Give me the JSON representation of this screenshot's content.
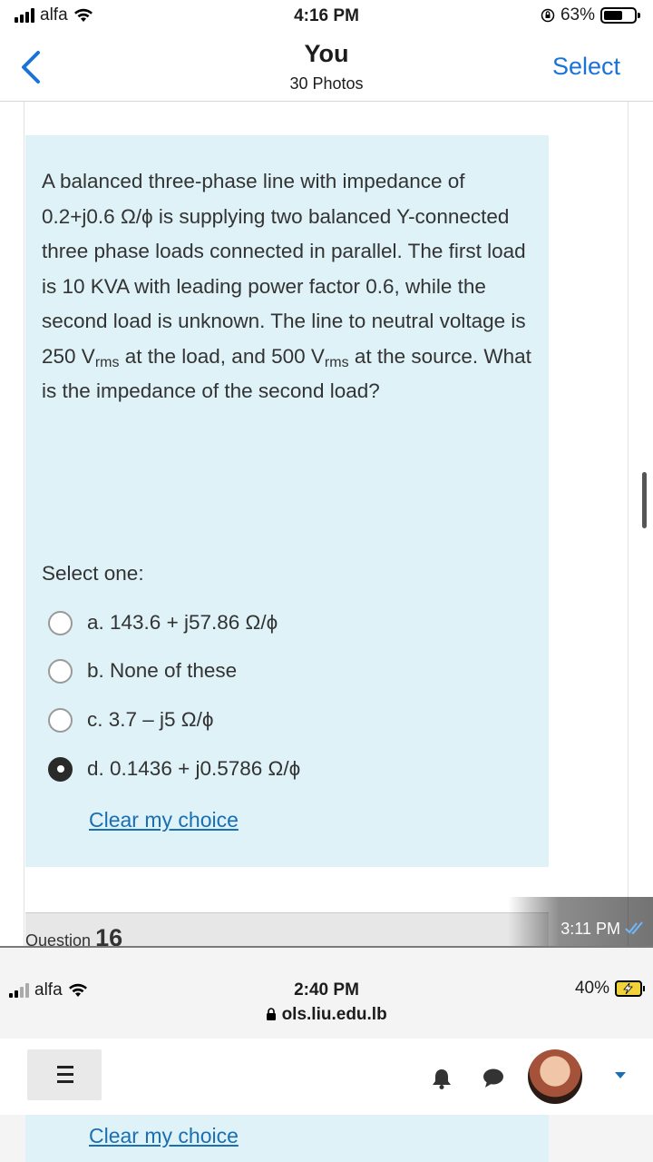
{
  "status_bar": {
    "carrier": "alfa",
    "time": "4:16 PM",
    "battery": "63%",
    "battery_level": 0.63
  },
  "nav": {
    "title": "You",
    "subtitle": "30 Photos",
    "select_label": "Select"
  },
  "question": {
    "text_parts": [
      "A balanced three-phase line with impedance of 0.2+j0.6 Ω/ϕ is supplying two balanced Y-connected three phase loads connected in parallel. The first load is 10 KVA with leading power factor 0.6, while the second load is unknown. The line to neutral voltage is 250 V",
      "rms",
      " at the load, and 500 V",
      "rms",
      " at the source. What is the impedance of the second load?"
    ],
    "select_one": "Select one:",
    "options": [
      {
        "label": "a. 143.6 + j57.86 Ω/ϕ",
        "selected": false
      },
      {
        "label": "b. None of these",
        "selected": false
      },
      {
        "label": "c. 3.7 – j5 Ω/ϕ",
        "selected": false
      },
      {
        "label": "d. 0.1436 + j0.5786 Ω/ϕ",
        "selected": true
      }
    ],
    "clear_choice": "Clear my choice",
    "next_question_label": "Question",
    "next_question_number": "16"
  },
  "message_time": "3:11 PM",
  "second_screenshot": {
    "carrier": "alfa",
    "time": "2:40 PM",
    "url": "ols.liu.edu.lb",
    "battery": "40%",
    "clear_choice": "Clear my choice"
  }
}
